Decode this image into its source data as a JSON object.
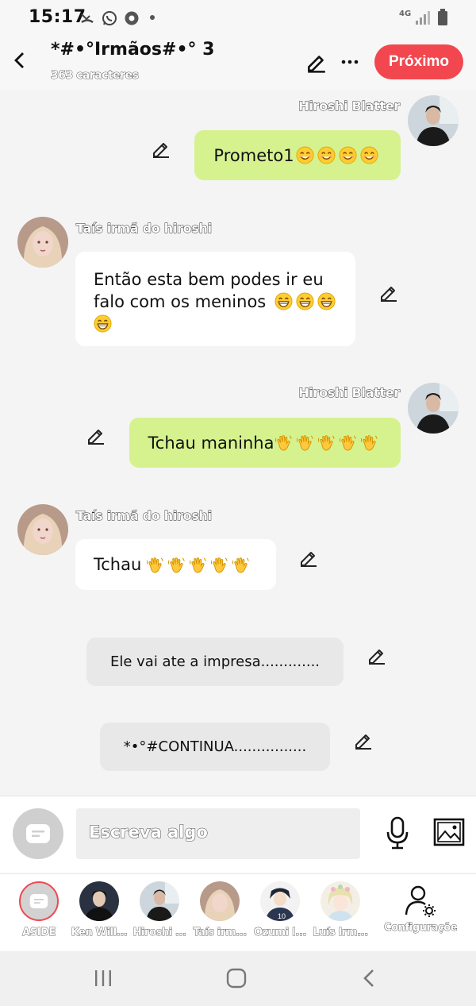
{
  "status_bar": {
    "time": "15:17",
    "network": "4G"
  },
  "header": {
    "title": "*#•°Irmãos#•° 3",
    "subtitle": "363 caracteres",
    "next_label": "Próximo"
  },
  "messages": [
    {
      "speaker": "Hiroshi  Blatter",
      "text": "Prometo1",
      "emoji": [
        "smile",
        "smile",
        "smile",
        "smile"
      ]
    },
    {
      "speaker": "Taís irmã do hiroshi",
      "line1": "Então esta bem podes ir eu",
      "line2": "falo com os meninos",
      "emoji": [
        "grin",
        "grin",
        "grin",
        "grin"
      ]
    },
    {
      "speaker": "Hiroshi  Blatter",
      "text": "Tchau maninha",
      "emoji": [
        "wave",
        "wave",
        "wave",
        "wave",
        "wave"
      ]
    },
    {
      "speaker": "Taís irmã do hiroshi",
      "text": "Tchau",
      "emoji": [
        "wave",
        "wave",
        "wave",
        "wave",
        "wave"
      ]
    }
  ],
  "narration": [
    {
      "text": "Ele vai ate a impresa............."
    },
    {
      "text": "*•°#CONTINUA................"
    }
  ],
  "input": {
    "placeholder": "Escreva algo"
  },
  "characters": [
    {
      "label": "ASIDE"
    },
    {
      "label": "Ken Will..."
    },
    {
      "label": "Hiroshi ..."
    },
    {
      "label": "Taís irm..."
    },
    {
      "label": "Ozumi I..."
    },
    {
      "label": "Luís Irm..."
    },
    {
      "label": "Configurações"
    }
  ],
  "colors": {
    "accent": "#f2474f",
    "bubble_green": "#d6f28f",
    "bubble_white": "#ffffff",
    "narration": "#e8e8e8"
  }
}
